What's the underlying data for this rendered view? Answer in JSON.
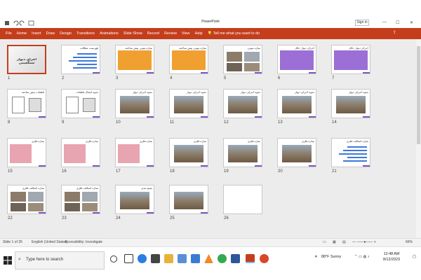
{
  "window": {
    "title": "PowerPoint",
    "sign_in": "Sign in"
  },
  "ribbon": {
    "tabs": [
      "File",
      "Home",
      "Insert",
      "Draw",
      "Design",
      "Transitions",
      "Animations",
      "Slide Show",
      "Record",
      "Review",
      "View",
      "Help"
    ],
    "tell_me": "Tell me what you want to do"
  },
  "colors": {
    "ribbon": "#c43e1c",
    "slide_purple": "#7e57c2",
    "slide_orange": "#f0a030",
    "slide_violet": "#9b6fd6",
    "slide_pink": "#e8a4b0"
  },
  "slides": [
    {
      "num": "1",
      "title": "اجرای دیوار سنگچینی",
      "style": "title"
    },
    {
      "num": "2",
      "title": "فهرست مطالب",
      "style": "list"
    },
    {
      "num": "3",
      "title": "سازه بتونی پیش ساخته",
      "style": "orange"
    },
    {
      "num": "4",
      "title": "سازه بتونی پیش ساخته",
      "style": "orange"
    },
    {
      "num": "5",
      "title": "سازه بتونی",
      "style": "photos"
    },
    {
      "num": "6",
      "title": "اجرای دیوار حائل",
      "style": "violet"
    },
    {
      "num": "7",
      "title": "اجرای دیوار حائل",
      "style": "violet"
    },
    {
      "num": "8",
      "title": "قطعات پیش ساخته",
      "style": "diagram"
    },
    {
      "num": "9",
      "title": "نحوه اتصال قطعات",
      "style": "diagram"
    },
    {
      "num": "10",
      "title": "نحوه اجرای دیوار",
      "style": "photo"
    },
    {
      "num": "11",
      "title": "نحوه اجرای دیوار",
      "style": "photo"
    },
    {
      "num": "12",
      "title": "نحوه اجرای دیوار",
      "style": "photo"
    },
    {
      "num": "13",
      "title": "نحوه اجرای دیوار",
      "style": "photo"
    },
    {
      "num": "14",
      "title": "نحوه اجرای دیوار",
      "style": "photo"
    },
    {
      "num": "15",
      "title": "سازه فلزی",
      "style": "pink"
    },
    {
      "num": "16",
      "title": "سازه فلزی",
      "style": "pink"
    },
    {
      "num": "17",
      "title": "سازه فلزی",
      "style": "pink"
    },
    {
      "num": "18",
      "title": "سازه فلزی",
      "style": "photo"
    },
    {
      "num": "19",
      "title": "سازه فلزی",
      "style": "photo"
    },
    {
      "num": "20",
      "title": "سازه فلزی",
      "style": "photo"
    },
    {
      "num": "21",
      "title": "سازه اسکلت فلزی",
      "style": "text"
    },
    {
      "num": "22",
      "title": "سازه اسکلت فلزی",
      "style": "photos"
    },
    {
      "num": "23",
      "title": "سازه اسکلت فلزی",
      "style": "photos"
    },
    {
      "num": "24",
      "title": "سیم بندی",
      "style": "photo"
    },
    {
      "num": "25",
      "title": "",
      "style": "photo"
    },
    {
      "num": "26",
      "title": "",
      "style": "blank"
    }
  ],
  "status": {
    "slide_count": "Slide 1 of 26",
    "language": "English (United States)",
    "accessibility": "Accessibility: Investigate",
    "zoom": "66%"
  },
  "taskbar": {
    "search_placeholder": "Type here to search",
    "weather": "88°F  Sunny",
    "time": "12:48 AM",
    "date": "8/12/2023"
  }
}
